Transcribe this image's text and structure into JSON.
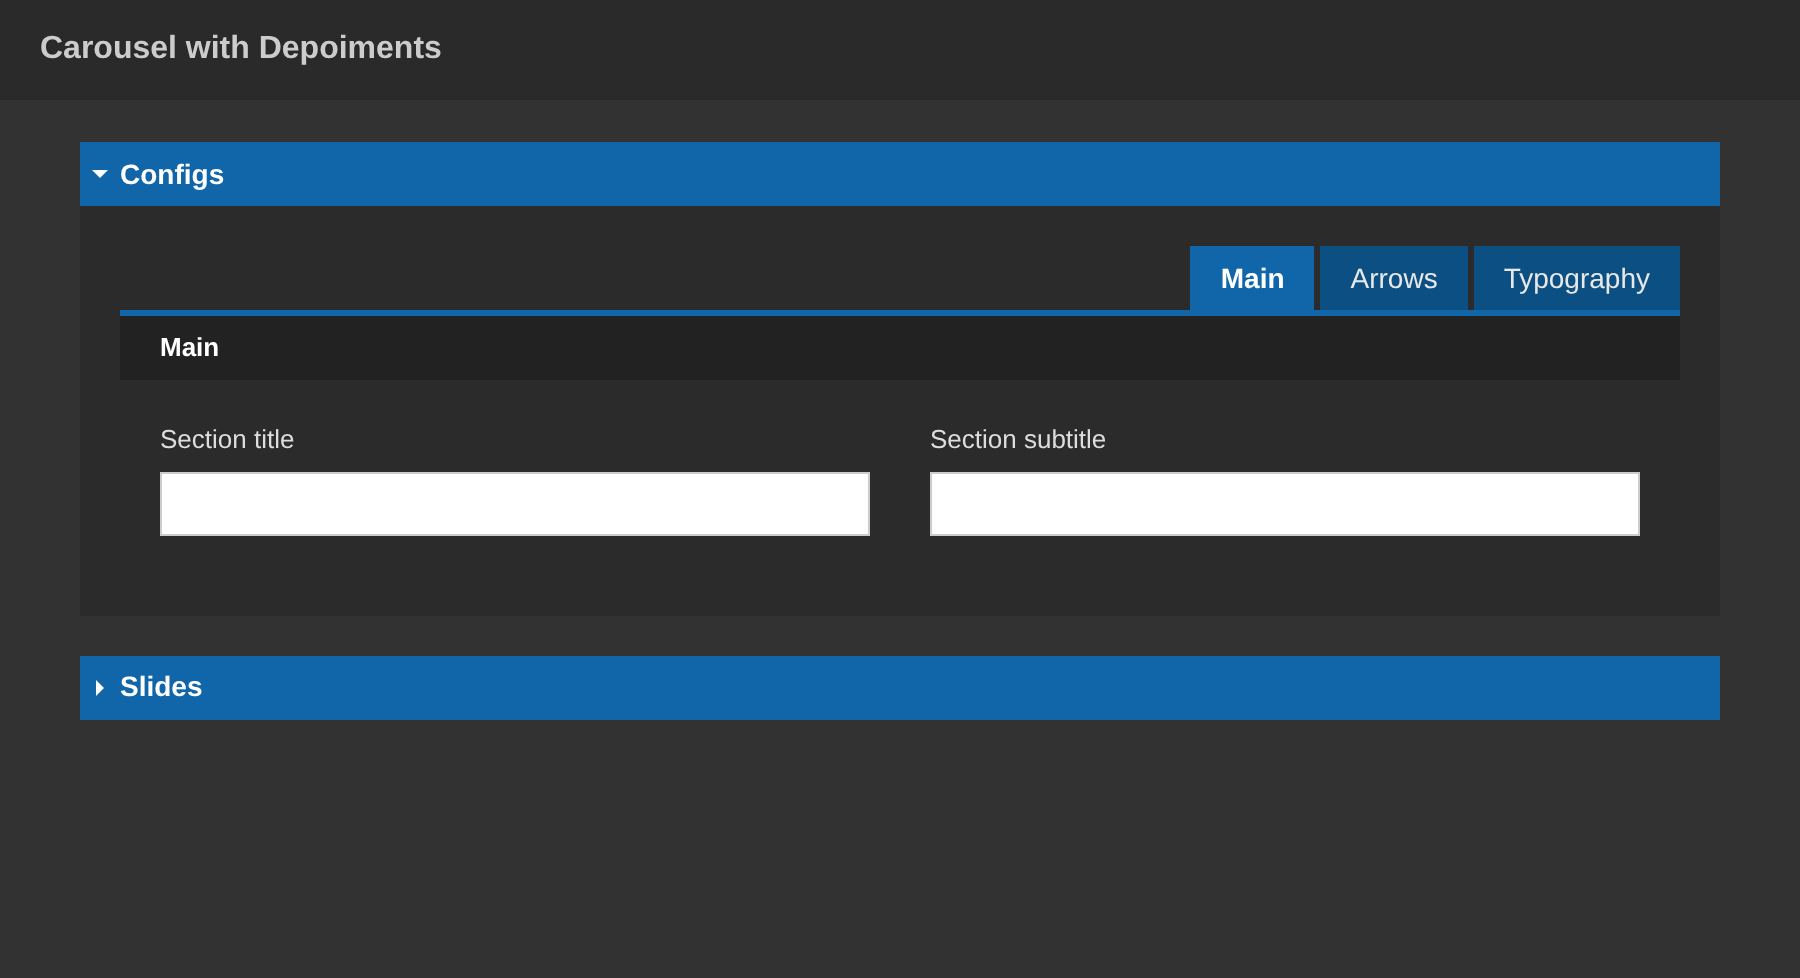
{
  "window": {
    "title": "Carousel with Depoiments"
  },
  "sections": [
    {
      "title": "Configs",
      "expanded": true,
      "tabs": [
        {
          "label": "Main",
          "selected": true
        },
        {
          "label": "Arrows",
          "selected": false
        },
        {
          "label": "Typography",
          "selected": false
        }
      ],
      "subheader": "Main",
      "fields": [
        {
          "label": "Section title"
        },
        {
          "label": "Section subtitle"
        }
      ]
    },
    {
      "title": "Slides",
      "expanded": false
    }
  ]
}
